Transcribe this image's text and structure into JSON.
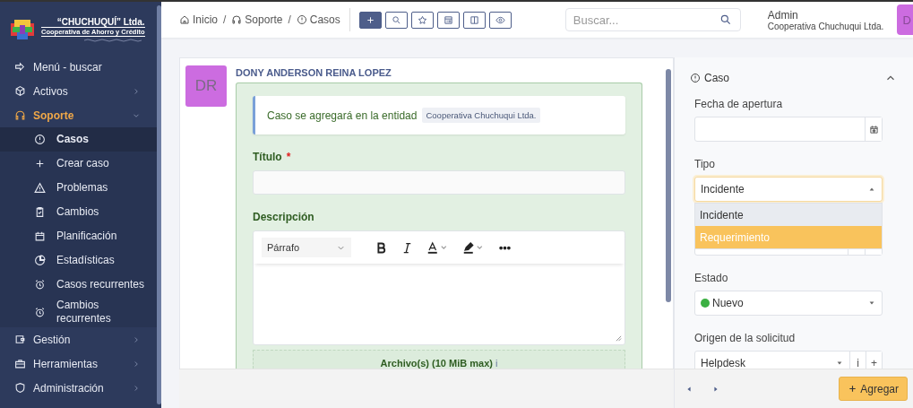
{
  "brand": {
    "name": "“CHUCHUQUÍ” Ltda.",
    "subtitle": "Cooperativa de Ahorro y Crédito"
  },
  "sidebar": {
    "items": [
      {
        "kind": "link",
        "label": "Menú - buscar"
      },
      {
        "kind": "group",
        "label": "Activos",
        "expanded": false,
        "selected": false
      },
      {
        "kind": "group",
        "label": "Soporte",
        "expanded": true,
        "selected": true,
        "children": [
          {
            "label": "Casos",
            "selected": true
          },
          {
            "label": "Crear caso",
            "selected": false
          },
          {
            "label": "Problemas",
            "selected": false
          },
          {
            "label": "Cambios",
            "selected": false
          },
          {
            "label": "Planificación",
            "selected": false
          },
          {
            "label": "Estadísticas",
            "selected": false
          },
          {
            "label": "Casos recurrentes",
            "selected": false
          },
          {
            "label": "Cambios recurrentes",
            "selected": false
          }
        ]
      },
      {
        "kind": "group",
        "label": "Gestión",
        "expanded": false,
        "selected": false
      },
      {
        "kind": "group",
        "label": "Herramientas",
        "expanded": false,
        "selected": false
      },
      {
        "kind": "group",
        "label": "Administración",
        "expanded": false,
        "selected": false
      }
    ]
  },
  "breadcrumb": [
    {
      "label": "Inicio"
    },
    {
      "label": "Soporte"
    },
    {
      "label": "Casos"
    }
  ],
  "breadcrumb_separator": "/",
  "search": {
    "placeholder": "Buscar..."
  },
  "user": {
    "name": "Admin",
    "entity": "Cooperativa Chuchuqui Ltda.",
    "avatar": "D"
  },
  "ticket": {
    "avatar": "DR",
    "author": "DONY ANDERSON REINA LOPEZ",
    "notice": {
      "text": "Caso se agregará en la entidad",
      "entity": "Cooperativa Chuchuqui Ltda."
    },
    "title_field": {
      "label": "Título",
      "required": true,
      "required_mark": "*"
    },
    "description_label": "Descripción",
    "editor": {
      "block_format": "Párrafo"
    },
    "attachments": {
      "label": "Archivo(s) (10 MiB max)",
      "info": "i"
    }
  },
  "panel": {
    "title": "Caso",
    "expanded": true,
    "fields": [
      {
        "kind": "date",
        "label": "Fecha de apertura"
      },
      {
        "kind": "open_select",
        "label": "Tipo",
        "value": "Incidente",
        "options": [
          {
            "label": "Incidente",
            "selected": true,
            "highlighted": false
          },
          {
            "label": "Requerimiento",
            "selected": false,
            "highlighted": true
          }
        ]
      },
      {
        "kind": "status",
        "label": "Estado",
        "value": "Nuevo",
        "color": "#3cb043"
      },
      {
        "kind": "select_actions",
        "label": "Origen de la solicitud",
        "value": "Helpdesk",
        "info": "i",
        "add": "+"
      }
    ]
  },
  "footer": {
    "add_button": "Agregar"
  }
}
